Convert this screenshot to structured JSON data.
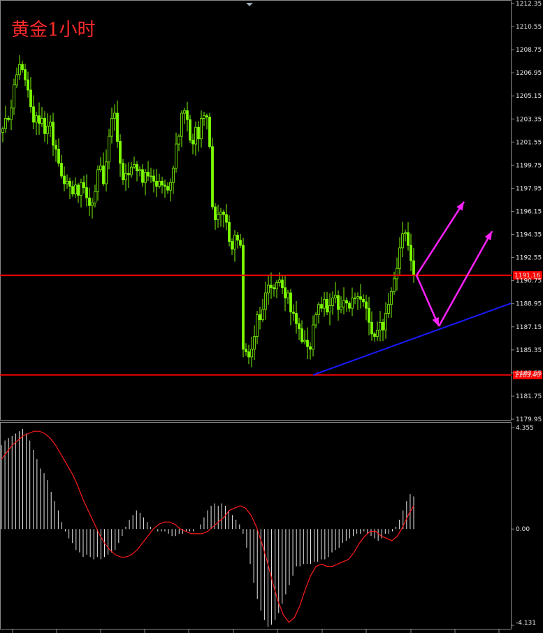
{
  "title": "黄金1小时",
  "chart_data": {
    "type": "candlestick",
    "price_axis": {
      "ylim": [
        1179.95,
        1212.35
      ],
      "ticks": [
        "1212.35",
        "1210.55",
        "1208.75",
        "1206.95",
        "1205.15",
        "1203.35",
        "1201.55",
        "1199.75",
        "1197.95",
        "1196.15",
        "1194.35",
        "1192.55",
        "1190.75",
        "1188.95",
        "1187.15",
        "1185.35",
        "1183.55",
        "1181.75",
        "1179.95"
      ]
    },
    "horizontal_levels": [
      {
        "label": "1191.16",
        "value": 1191.16,
        "color": "#ff0000"
      },
      {
        "label": "1183.40",
        "value": 1183.4,
        "color": "#ff0000"
      }
    ],
    "trendline": {
      "color": "#1a1aff",
      "from": {
        "bar": 111,
        "price": 1183.4
      },
      "to": {
        "bar": 182,
        "price": 1189.0
      }
    },
    "arrows": [
      {
        "color": "#ff22ff",
        "from": {
          "bar": 148,
          "price": 1191.16
        },
        "to": {
          "bar": 165,
          "price": 1196.9
        }
      },
      {
        "color": "#ff22ff",
        "from": {
          "bar": 148,
          "price": 1191.16
        },
        "to": {
          "bar": 156,
          "price": 1187.2
        }
      },
      {
        "color": "#ff22ff",
        "from": {
          "bar": 156,
          "price": 1187.2
        },
        "to": {
          "bar": 175,
          "price": 1194.6
        }
      }
    ],
    "closes": [
      1202.6,
      1203.4,
      1203.3,
      1204.2,
      1206.0,
      1206.8,
      1207.6,
      1207.2,
      1206.4,
      1205.6,
      1204.3,
      1203.1,
      1203.6,
      1203.0,
      1203.4,
      1202.2,
      1202.8,
      1203.1,
      1201.3,
      1201.0,
      1199.9,
      1198.9,
      1198.3,
      1198.5,
      1198.1,
      1197.5,
      1198.2,
      1197.4,
      1198.4,
      1198.0,
      1197.2,
      1196.6,
      1196.8,
      1197.7,
      1199.4,
      1199.7,
      1198.3,
      1200.0,
      1202.0,
      1203.4,
      1203.8,
      1201.6,
      1199.9,
      1198.6,
      1199.1,
      1199.0,
      1199.6,
      1199.8,
      1199.3,
      1199.4,
      1198.4,
      1199.2,
      1198.9,
      1198.9,
      1198.5,
      1198.1,
      1198.5,
      1198.2,
      1198.1,
      1197.8,
      1198.4,
      1199.5,
      1201.4,
      1202.0,
      1203.8,
      1204.0,
      1203.3,
      1201.7,
      1201.4,
      1202.7,
      1201.8,
      1203.4,
      1203.6,
      1203.5,
      1201.2,
      1196.5,
      1195.5,
      1195.9,
      1196.1,
      1195.9,
      1195.3,
      1193.8,
      1193.2,
      1194.3,
      1193.9,
      1193.5,
      1185.4,
      1185.2,
      1184.8,
      1185.4,
      1186.4,
      1188.1,
      1187.7,
      1188.5,
      1189.8,
      1190.4,
      1190.2,
      1190.1,
      1190.6,
      1190.8,
      1190.2,
      1189.4,
      1189.8,
      1188.3,
      1188.2,
      1187.4,
      1187.0,
      1186.0,
      1186.1,
      1185.6,
      1185.4,
      1187.3,
      1188.1,
      1188.9,
      1188.6,
      1189.3,
      1188.3,
      1188.8,
      1189.4,
      1189.6,
      1188.5,
      1188.7,
      1189.2,
      1189.0,
      1188.6,
      1189.4,
      1189.4,
      1189.5,
      1189.3,
      1189.1,
      1188.6,
      1187.5,
      1186.6,
      1186.4,
      1186.9,
      1187.5,
      1186.9,
      1188.2,
      1188.9,
      1189.9,
      1190.9,
      1191.7,
      1193.3,
      1194.4,
      1194.5,
      1193.5,
      1192.3,
      1191.16
    ],
    "macd_panel": {
      "ylim": [
        -4.131,
        4.355
      ],
      "ticks": [
        "4.355",
        "0.00",
        "-4.131"
      ],
      "histogram": [
        3.6,
        3.8,
        3.9,
        4.0,
        4.1,
        4.2,
        4.3,
        4.1,
        3.8,
        3.4,
        3.0,
        2.6,
        2.4,
        2.1,
        1.6,
        1.2,
        0.8,
        0.3,
        -0.1,
        -0.4,
        -0.6,
        -0.9,
        -1.0,
        -1.2,
        -1.1,
        -1.2,
        -1.3,
        -1.2,
        -1.3,
        -1.2,
        -1.1,
        -1.0,
        -0.9,
        -0.6,
        -0.3,
        0.1,
        0.4,
        0.6,
        0.8,
        0.7,
        0.5,
        0.3,
        0.1,
        0.0,
        -0.1,
        -0.1,
        -0.1,
        -0.2,
        -0.3,
        -0.3,
        -0.2,
        -0.2,
        -0.1,
        -0.1,
        -0.1,
        0.0,
        0.2,
        0.5,
        0.8,
        1.0,
        1.1,
        1.0,
        1.1,
        1.0,
        0.8,
        0.6,
        0.4,
        0.2,
        -0.2,
        -0.8,
        -1.5,
        -2.3,
        -3.0,
        -3.5,
        -3.9,
        -4.2,
        -4.1,
        -3.9,
        -3.6,
        -3.2,
        -2.8,
        -2.4,
        -2.0,
        -1.6,
        -1.6,
        -1.5,
        -1.5,
        -1.5,
        -1.4,
        -1.4,
        -1.3,
        -1.3,
        -1.2,
        -1.0,
        -0.9,
        -0.8,
        -0.6,
        -0.5,
        -0.4,
        -0.3,
        -0.2,
        -0.2,
        -0.1,
        -0.2,
        -0.3,
        -0.4,
        -0.5,
        -0.4,
        -0.2,
        -0.2,
        -0.1,
        0.1,
        0.4,
        0.8,
        1.2,
        1.5,
        1.4
      ],
      "signal": [
        3.0,
        3.3,
        3.6,
        3.8,
        4.0,
        4.1,
        4.2,
        4.2,
        4.1,
        3.9,
        3.6,
        3.2,
        2.8,
        2.4,
        1.9,
        1.3,
        0.8,
        0.3,
        -0.2,
        -0.6,
        -0.9,
        -1.1,
        -1.2,
        -1.2,
        -1.1,
        -0.9,
        -0.6,
        -0.3,
        0.0,
        0.2,
        0.3,
        0.3,
        0.2,
        0.0,
        -0.1,
        -0.2,
        -0.2,
        -0.2,
        -0.1,
        0.1,
        0.3,
        0.5,
        0.8,
        0.9,
        1.0,
        0.9,
        0.6,
        0.1,
        -0.6,
        -1.4,
        -2.3,
        -3.1,
        -3.7,
        -4.0,
        -3.8,
        -3.3,
        -2.6,
        -2.0,
        -1.6,
        -1.5,
        -1.6,
        -1.6,
        -1.5,
        -1.4,
        -1.3,
        -1.0,
        -0.6,
        -0.3,
        -0.1,
        -0.1,
        -0.3,
        -0.4,
        -0.5,
        -0.3,
        0.1,
        0.6,
        1.0
      ]
    }
  }
}
